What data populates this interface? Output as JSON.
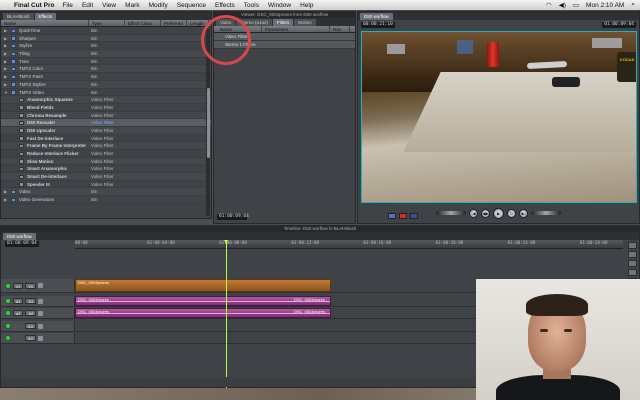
{
  "menubar": {
    "app_name": "Final Cut Pro",
    "menus": [
      "File",
      "Edit",
      "View",
      "Mark",
      "Modify",
      "Sequence",
      "Effects",
      "Tools",
      "Window",
      "Help"
    ],
    "active_menu": "Effects",
    "clock": "Mon 2:10 AM"
  },
  "browser": {
    "tabs": [
      "BLAHblusb",
      "Effects"
    ],
    "selected_tab": "Effects",
    "columns": [
      "Name",
      "Type",
      "Effect Class",
      "Preferred",
      "Length"
    ],
    "rows": [
      {
        "name": "QuickTime",
        "type": "Bin",
        "level": 0
      },
      {
        "name": "Sharpen",
        "type": "Bin",
        "level": 0
      },
      {
        "name": "Stylize",
        "type": "Bin",
        "level": 0
      },
      {
        "name": "Tiling",
        "type": "Bin",
        "level": 0
      },
      {
        "name": "Time",
        "type": "Bin",
        "level": 0
      },
      {
        "name": "TMTS Color",
        "type": "Bin",
        "level": 0
      },
      {
        "name": "TMTS Paint",
        "type": "Bin",
        "level": 0
      },
      {
        "name": "TMTS Stylize",
        "type": "Bin",
        "level": 0
      },
      {
        "name": "TMTS Video",
        "type": "Bin",
        "level": 0,
        "open": true
      },
      {
        "name": "Anamorphic Squeeze",
        "type": "Video Filter",
        "level": 1
      },
      {
        "name": "Blend Fields",
        "type": "Video Filter",
        "level": 1
      },
      {
        "name": "Chroma Resample",
        "type": "Video Filter",
        "level": 1
      },
      {
        "name": "D50 Rescaler",
        "type": "Video Filter",
        "level": 1,
        "highlight": true
      },
      {
        "name": "D50 Upscaler",
        "type": "Video Filter",
        "level": 1
      },
      {
        "name": "Fast De-interlace",
        "type": "Video Filter",
        "level": 1
      },
      {
        "name": "Frame By Frame Interpreter",
        "type": "Video Filter",
        "level": 1
      },
      {
        "name": "Reduce Interlace Flicker",
        "type": "Video Filter",
        "level": 1
      },
      {
        "name": "Slow Motion",
        "type": "Video Filter",
        "level": 1
      },
      {
        "name": "Smart Anamorphic",
        "type": "Video Filter",
        "level": 1
      },
      {
        "name": "Smart De-interlace",
        "type": "Video Filter",
        "level": 1
      },
      {
        "name": "Speeder III",
        "type": "Video Filter",
        "level": 1
      },
      {
        "name": "Video",
        "type": "Bin",
        "level": 0
      },
      {
        "name": "Video Generators",
        "type": "Bin",
        "level": 0
      }
    ]
  },
  "viewer": {
    "title": "Viewer: DSC_0004prores from D50 worflow",
    "tabs": [
      "Video",
      "Stereo (a1a2)",
      "Filters",
      "Motion"
    ],
    "selected_tab": "Filters",
    "columns": [
      "Name",
      "Parameters",
      "Nav"
    ],
    "rows": [
      "Video Filters",
      "Stereo 1 Filters"
    ],
    "timecode": "01:00:09:04"
  },
  "canvas": {
    "title": "Canvas: D50 worflow",
    "tab": "D50 worflow",
    "timecode_left": "00:00:21:10",
    "timecode_right": "01:00:09:04",
    "zoom": "100%",
    "overlay_text": "KODAK"
  },
  "timeline": {
    "title": "Timeline: D50 worflow in BLAHblusb",
    "tab": "D50 worflow",
    "current_timecode": "01:00:09:04",
    "ruler_ticks": [
      "00:00",
      "01:00:04:00",
      "01:00:08:00",
      "01:00:12:00",
      "01:00:16:00",
      "01:00:20:00",
      "01:00:24:00",
      "01:00:28:00"
    ],
    "tracks": [
      {
        "src": "v1",
        "dst": "V1",
        "kind": "video",
        "clip": "DSC_0004prores",
        "clip_end": ""
      },
      {
        "src": "a1",
        "dst": "A1",
        "kind": "audio",
        "clip": "DSC_0004prores",
        "clip_end": "DSC_0004prores"
      },
      {
        "src": "a2",
        "dst": "A2",
        "kind": "audio",
        "clip": "DSC_0004prores",
        "clip_end": "DSC_0004prores"
      },
      {
        "src": "",
        "dst": "A3",
        "kind": "empty",
        "clip": "",
        "clip_end": ""
      },
      {
        "src": "",
        "dst": "A4",
        "kind": "empty",
        "clip": "",
        "clip_end": ""
      }
    ],
    "sequence_track_label": "ST"
  },
  "colors": {
    "video_clip": "#c07a35",
    "audio_clip": "#b05aa0",
    "playhead": "#b6ff3a",
    "highlight_circle": "#d9474e",
    "canvas_border": "#1fb5b5"
  }
}
